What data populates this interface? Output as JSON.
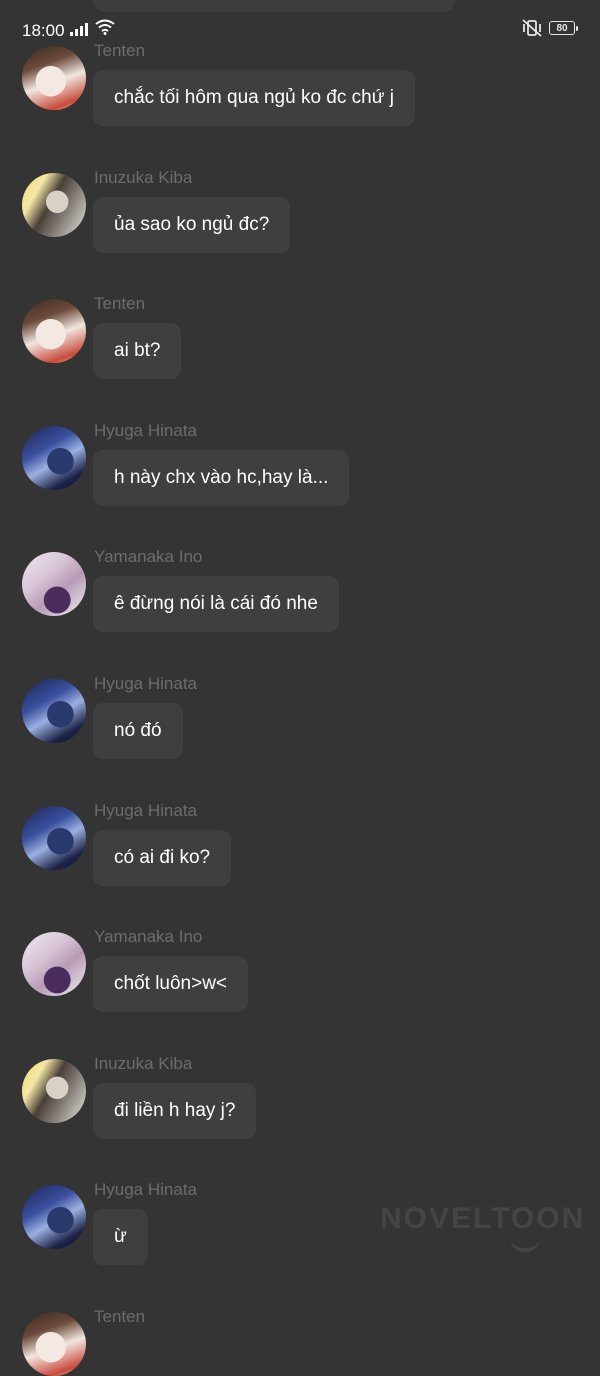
{
  "status": {
    "time": "18:00",
    "battery": "80"
  },
  "messages": [
    {
      "sender": "Tenten",
      "avatar": "tenten-avatar",
      "text": "chắc tối hôm qua ngủ ko đc chứ j"
    },
    {
      "sender": "Inuzuka Kiba",
      "avatar": "kiba-avatar",
      "text": "ủa sao ko ngủ đc?"
    },
    {
      "sender": "Tenten",
      "avatar": "tenten-avatar",
      "text": "ai bt?"
    },
    {
      "sender": "Hyuga Hinata",
      "avatar": "hinata-avatar",
      "text": "h này chx vào hc,hay là..."
    },
    {
      "sender": "Yamanaka Ino",
      "avatar": "ino-avatar",
      "text": "ê đừng nói là cái đó nhe"
    },
    {
      "sender": "Hyuga Hinata",
      "avatar": "hinata-avatar",
      "text": "nó đó"
    },
    {
      "sender": "Hyuga Hinata",
      "avatar": "hinata-avatar",
      "text": "có ai đi ko?"
    },
    {
      "sender": "Yamanaka Ino",
      "avatar": "ino-avatar",
      "text": "chốt luôn>w<"
    },
    {
      "sender": "Inuzuka Kiba",
      "avatar": "kiba-avatar",
      "text": "đi liền h hay j?"
    },
    {
      "sender": "Hyuga Hinata",
      "avatar": "hinata-avatar",
      "text": "ừ"
    },
    {
      "sender": "Tenten",
      "avatar": "tenten-avatar",
      "text": ""
    }
  ],
  "watermark": "NOVELTOON",
  "colors": {
    "background": "#343434",
    "bubble": "#3f3f3f",
    "sender_name": "#6c6c6c",
    "text": "#ffffff"
  }
}
